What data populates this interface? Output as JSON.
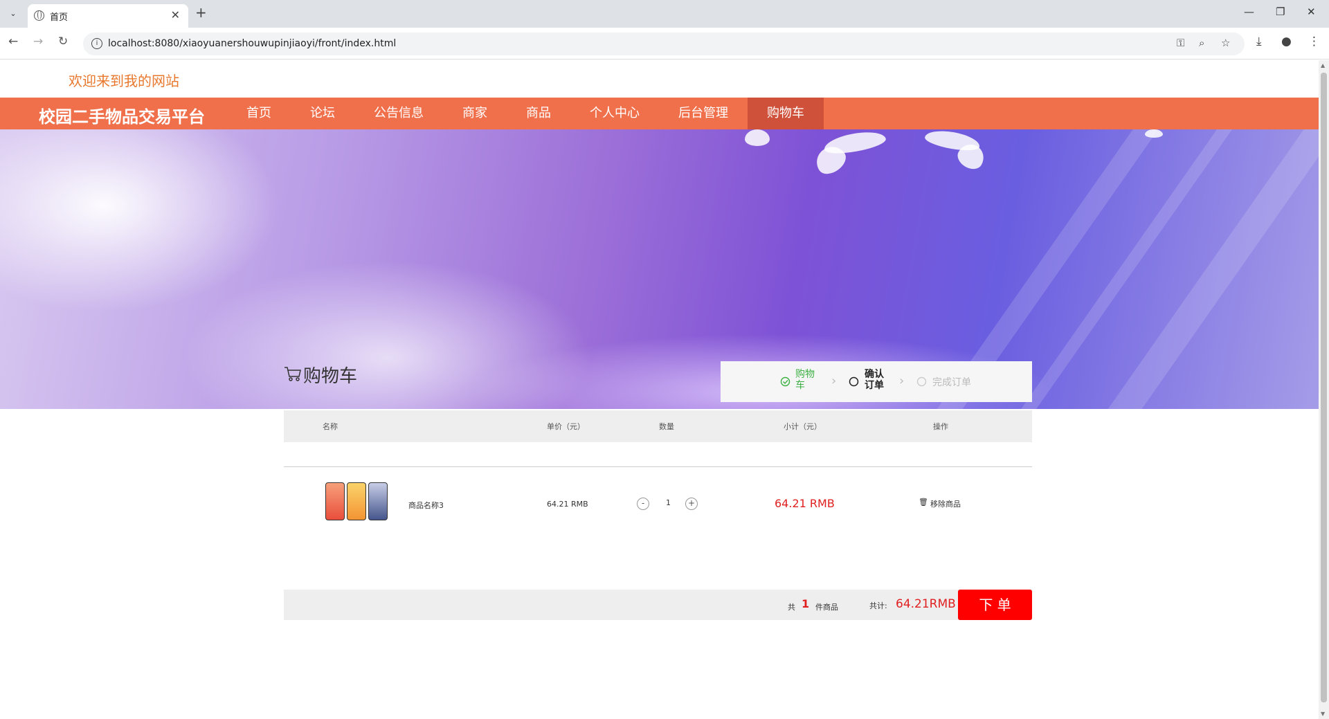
{
  "browser": {
    "tab_title": "首页",
    "url": "localhost:8080/xiaoyuanershouwupinjiaoyi/front/index.html"
  },
  "header": {
    "welcome": "欢迎来到我的网站",
    "brand": "校园二手物品交易平台"
  },
  "nav": [
    {
      "label": "首页"
    },
    {
      "label": "论坛"
    },
    {
      "label": "公告信息"
    },
    {
      "label": "商家"
    },
    {
      "label": "商品"
    },
    {
      "label": "个人中心"
    },
    {
      "label": "后台管理"
    },
    {
      "label": "购物车",
      "active": true
    }
  ],
  "carousel": {
    "slides": 3,
    "active_index": 0,
    "active_color": "#f0704c"
  },
  "cart": {
    "title": "购物车",
    "steps": {
      "cart": "购物\n车",
      "confirm": "确认\n订单",
      "done": "完成订单"
    },
    "columns": {
      "name": "名称",
      "price": "单价（元）",
      "qty": "数量",
      "subtotal": "小计（元）",
      "action": "操作"
    },
    "items": [
      {
        "name": "商品名称3",
        "price": "64.21 RMB",
        "qty": "1",
        "minus": "-",
        "plus": "+",
        "subtotal": "64.21 RMB",
        "remove": "移除商品"
      }
    ],
    "footer": {
      "count_prefix": "共",
      "count": "1",
      "count_suffix": "件商品",
      "total_label": "共计:",
      "total": "64.21RMB",
      "order_button": "下 单"
    }
  },
  "colors": {
    "accent": "#f0704c",
    "price": "#e02020",
    "order": "#ff0000",
    "step_done": "#3cb043"
  }
}
